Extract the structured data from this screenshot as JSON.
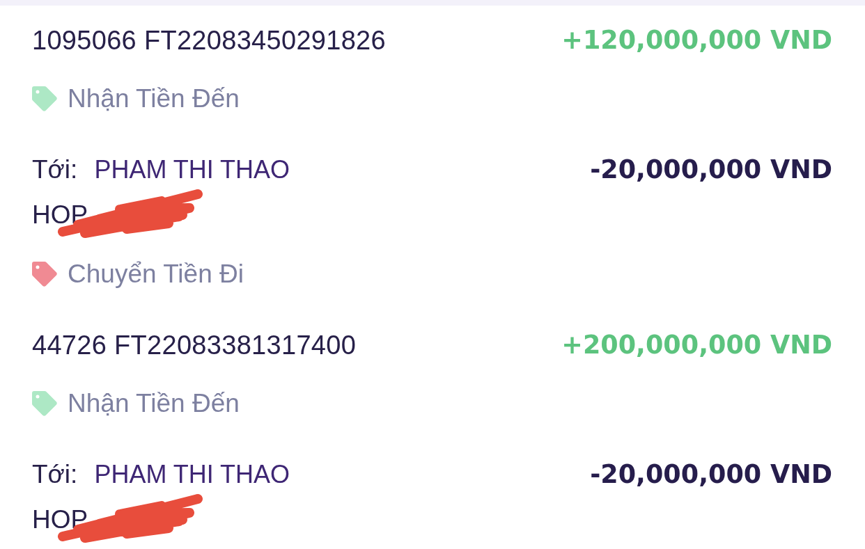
{
  "transactions": [
    {
      "kind": "incoming",
      "reference": "1095066 FT22083450291826",
      "amount": "+120,000,000 VND",
      "category": {
        "label": "Nhận Tiền Đến",
        "color": "#ade8c5"
      }
    },
    {
      "kind": "outgoing",
      "recipient_label": "Tới:",
      "recipient_name": "PHAM THI THAO",
      "recipient_detail": "HOP",
      "redacted": true,
      "amount": "-20,000,000 VND",
      "category": {
        "label": "Chuyển Tiền Đi",
        "color": "#f08a93"
      }
    },
    {
      "kind": "incoming",
      "reference": "44726 FT22083381317400",
      "amount": "+200,000,000 VND",
      "category": {
        "label": "Nhận Tiền Đến",
        "color": "#ade8c5"
      }
    },
    {
      "kind": "outgoing",
      "recipient_label": "Tới:",
      "recipient_name": "PHAM THI THAO",
      "recipient_detail": "HOP",
      "redacted": true,
      "amount": "-20,000,000 VND"
    }
  ]
}
